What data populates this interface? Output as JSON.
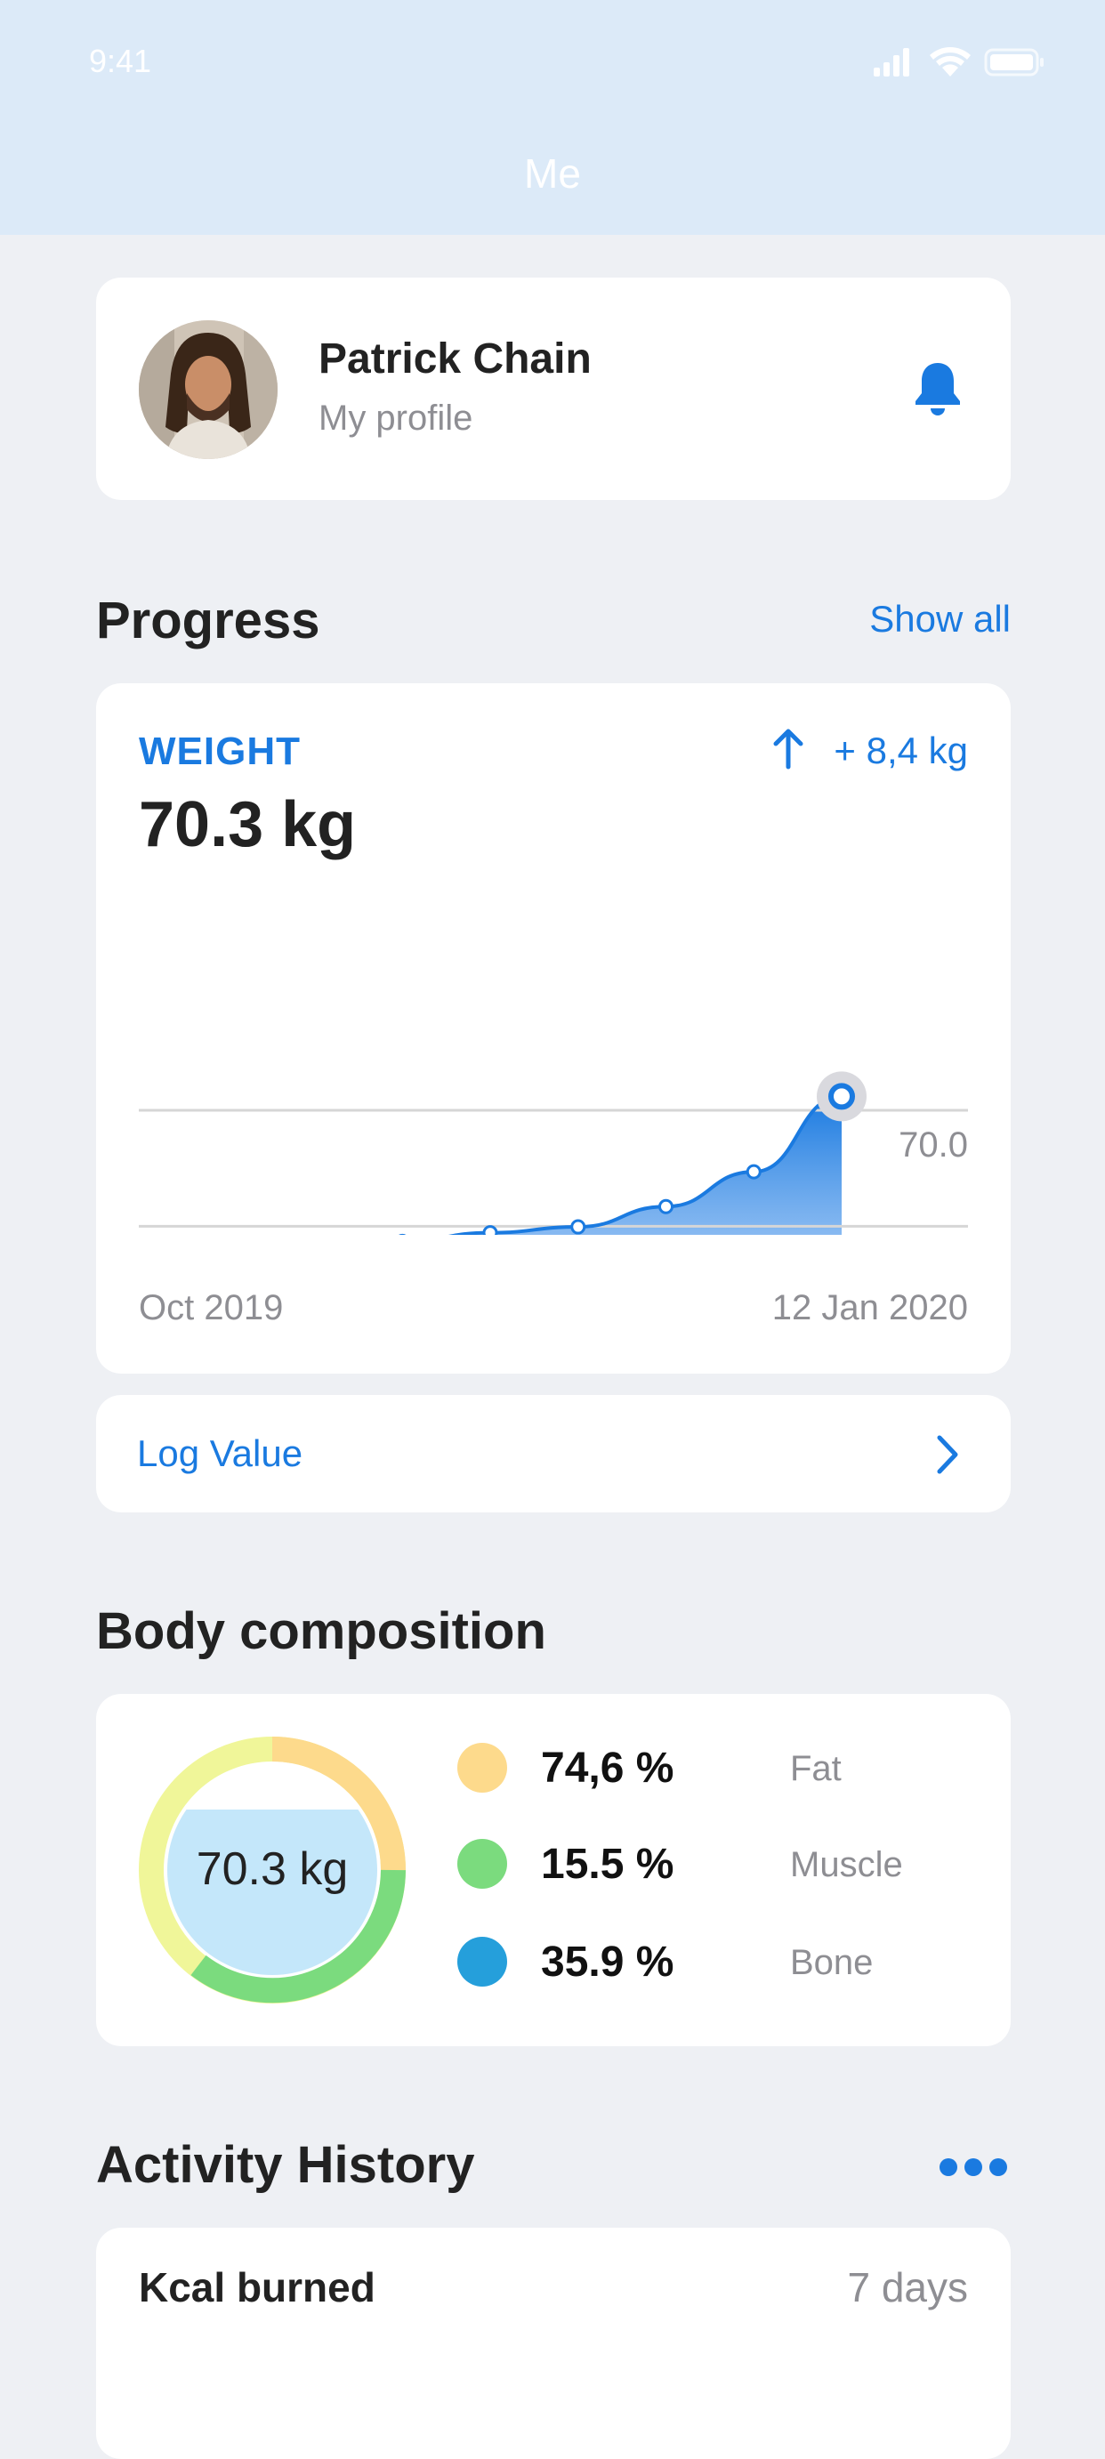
{
  "status_bar": {
    "time": "9:41"
  },
  "nav": {
    "title": "Me"
  },
  "profile": {
    "name": "Patrick Chain",
    "subtitle": "My profile"
  },
  "progress": {
    "title": "Progress",
    "show_all": "Show all",
    "metric": "WEIGHT",
    "delta": "+ 8,4 kg",
    "value": "70.3 kg",
    "start_label": "Oct 2019",
    "end_label": "12 Jan 2020"
  },
  "chart_data": {
    "type": "area",
    "x_labels": [
      "Oct 2019",
      "12 Jan 2020"
    ],
    "values": [
      62.0,
      64.2,
      65.7,
      66.4,
      66.7,
      66.9,
      67.6,
      68.8,
      71.4
    ],
    "yticks": [
      "70.0",
      "66.0",
      "62.0"
    ],
    "ylim": [
      58.0,
      72.0
    ],
    "color": "#1A7AE0"
  },
  "log_value": {
    "label": "Log Value"
  },
  "composition": {
    "title": "Body composition",
    "center": "70.3 kg",
    "items": [
      {
        "value": "74,6 %",
        "name": "Fat",
        "color": "#FDDA8C"
      },
      {
        "value": "15.5 %",
        "name": "Muscle",
        "color": "#7BDB7E"
      },
      {
        "value": "35.9 %",
        "name": "Bone",
        "color": "#259FDB"
      }
    ]
  },
  "activity": {
    "title": "Activity History",
    "card_title": "Kcal burned",
    "range": "7 days"
  },
  "colors": {
    "accent": "#1A7AE0",
    "header": "#DCEAF8",
    "background": "#EEF0F4"
  }
}
